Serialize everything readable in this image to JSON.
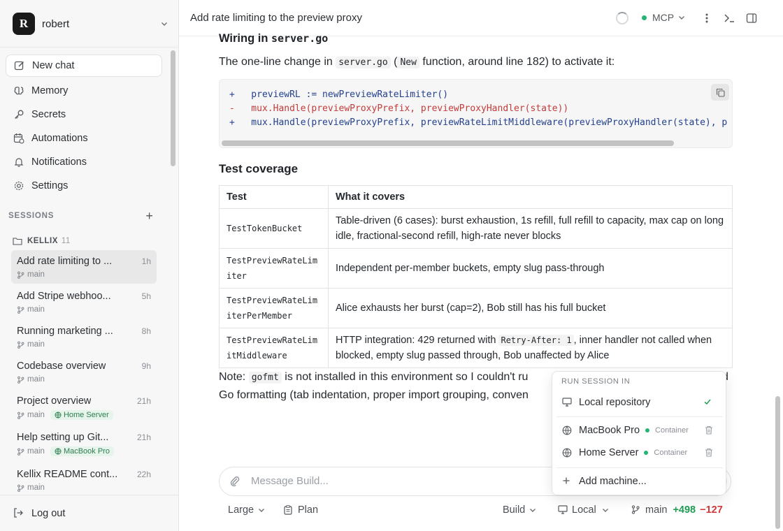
{
  "sidebar": {
    "avatar_letter": "R",
    "user_name": "robert",
    "nav": [
      {
        "label": "New chat",
        "icon": "edit-icon"
      },
      {
        "label": "Memory",
        "icon": "brain-icon"
      },
      {
        "label": "Secrets",
        "icon": "key-icon"
      },
      {
        "label": "Automations",
        "icon": "calendar-clock-icon"
      },
      {
        "label": "Notifications",
        "icon": "bell-icon"
      },
      {
        "label": "Settings",
        "icon": "gear-icon"
      }
    ],
    "sessions_label": "SESSIONS",
    "folder": {
      "name": "KELLIX",
      "count": "11"
    },
    "sessions": [
      {
        "title": "Add rate limiting to ...",
        "time": "1h",
        "branch": "main",
        "machine": ""
      },
      {
        "title": "Add Stripe webhoo...",
        "time": "5h",
        "branch": "main",
        "machine": ""
      },
      {
        "title": "Running marketing ...",
        "time": "8h",
        "branch": "main",
        "machine": ""
      },
      {
        "title": "Codebase overview",
        "time": "9h",
        "branch": "main",
        "machine": ""
      },
      {
        "title": "Project overview",
        "time": "21h",
        "branch": "main",
        "machine": "Home Server"
      },
      {
        "title": "Help setting up Git...",
        "time": "21h",
        "branch": "main",
        "machine": "MacBook Pro"
      },
      {
        "title": "Kellix README cont...",
        "time": "22h",
        "branch": "main",
        "machine": ""
      }
    ],
    "logout_label": "Log out"
  },
  "topbar": {
    "title": "Add rate limiting to the preview proxy",
    "mcp_label": "MCP"
  },
  "content": {
    "wiring_heading_prefix": "Wiring in",
    "wiring_heading_code": "server.go",
    "para1": {
      "p1": "The one-line change in",
      "code1": "server.go",
      "p2": "(",
      "code2": "New",
      "p3": "function, around line 182) to activate it:"
    },
    "code_lines": [
      {
        "kind": "add",
        "text": "+   previewRL := newPreviewRateLimiter()"
      },
      {
        "kind": "del",
        "text": "-   mux.Handle(previewProxyPrefix, previewProxyHandler(state))"
      },
      {
        "kind": "add",
        "text": "+   mux.Handle(previewProxyPrefix, previewRateLimitMiddleware(previewProxyHandler(state), p"
      }
    ],
    "test_heading": "Test coverage",
    "table": {
      "headers": [
        "Test",
        "What it covers"
      ],
      "rows": [
        {
          "test": "TestTokenBucket",
          "covers": "Table-driven (6 cases): burst exhaustion, 1s refill, full refill to capacity, max cap on long idle, fractional-second refill, high-rate never blocks"
        },
        {
          "test": "TestPreviewRateLimiter",
          "covers": "Independent per-member buckets, empty slug pass-through"
        },
        {
          "test": "TestPreviewRateLimiterPerMember",
          "covers": "Alice exhausts her burst (cap=2), Bob still has his full bucket"
        },
        {
          "test": "TestPreviewRateLimitMiddleware",
          "covers_a": "HTTP integration: 429 returned with",
          "covers_code": "Retry-After: 1",
          "covers_b": ", inner handler not called when blocked, empty slug passed through, Bob unaffected by Alice"
        }
      ]
    },
    "note": {
      "p1": "Note:",
      "code": "gofmt",
      "p2": "is not installed in this environment so I couldn't ru",
      "p3_end": "d",
      "line2": "Go formatting (tab indentation, proper import grouping, conven"
    }
  },
  "composer": {
    "placeholder": "Message Build..."
  },
  "bottombar": {
    "size": "Large",
    "plan": "Plan",
    "mode": "Build",
    "location": "Local",
    "branch": "main",
    "additions": "+498",
    "deletions": "−127"
  },
  "dropdown": {
    "heading": "RUN SESSION IN",
    "local": "Local repository",
    "machines": [
      {
        "name": "MacBook Pro",
        "tag": "Container"
      },
      {
        "name": "Home Server",
        "tag": "Container"
      }
    ],
    "add": "Add machine..."
  }
}
